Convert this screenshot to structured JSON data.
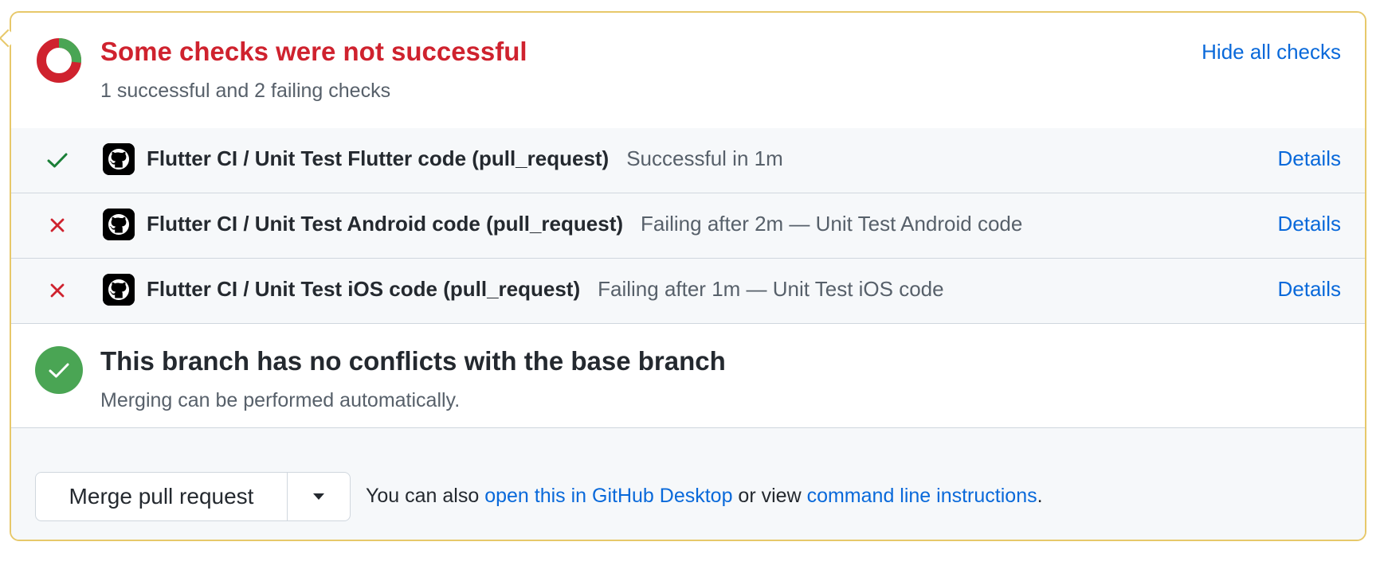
{
  "header": {
    "title": "Some checks were not successful",
    "subtitle": "1 successful and 2 failing checks",
    "hide_link": "Hide all checks",
    "donut": {
      "successful": 1,
      "failing": 2,
      "success_color": "#4aa554",
      "fail_color": "#cf222e"
    }
  },
  "checks": [
    {
      "status": "success",
      "icon": "check-icon",
      "name": "Flutter CI / Unit Test Flutter code (pull_request)",
      "description": "Successful in 1m",
      "details_label": "Details"
    },
    {
      "status": "failure",
      "icon": "x-icon",
      "name": "Flutter CI / Unit Test Android code (pull_request)",
      "description": "Failing after 2m — Unit Test Android code",
      "details_label": "Details"
    },
    {
      "status": "failure",
      "icon": "x-icon",
      "name": "Flutter CI / Unit Test iOS code (pull_request)",
      "description": "Failing after 1m — Unit Test iOS code",
      "details_label": "Details"
    }
  ],
  "merge_status": {
    "title": "This branch has no conflicts with the base branch",
    "subtitle": "Merging can be performed automatically."
  },
  "footer": {
    "merge_button": "Merge pull request",
    "text_prefix": "You can also ",
    "desktop_link": "open this in GitHub Desktop",
    "text_middle": " or view ",
    "cli_link": "command line instructions",
    "text_suffix": "."
  },
  "colors": {
    "warning_border": "#e7c86a",
    "danger": "#cf222e",
    "success": "#4aa554",
    "link": "#0969da"
  }
}
